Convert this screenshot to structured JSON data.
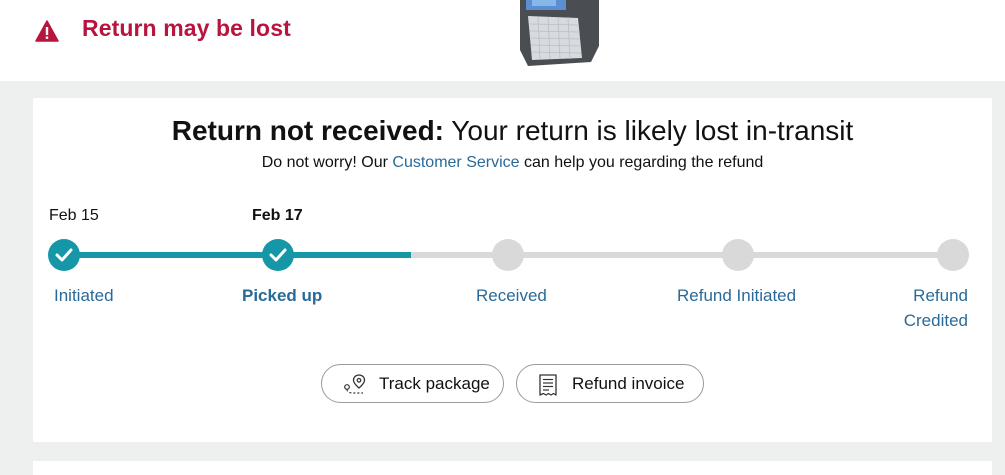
{
  "banner": {
    "title": "Return may be lost",
    "icon": "warning-triangle-icon",
    "accent_color": "#b7153e"
  },
  "status": {
    "heading_strong": "Return not received:",
    "heading_rest": " Your return is likely lost in-transit",
    "sub_before": "Do not worry! Our ",
    "sub_link": "Customer Service",
    "sub_after": " can help you regarding the refund"
  },
  "timeline": {
    "progress_color": "#1597a7",
    "pending_color": "#d9d9d9",
    "progress_fraction": 0.39,
    "steps": [
      {
        "label": "Initiated",
        "date": "Feb 15",
        "done": true,
        "current": false
      },
      {
        "label": "Picked up",
        "date": "Feb 17",
        "done": true,
        "current": true
      },
      {
        "label": "Received",
        "date": "",
        "done": false,
        "current": false
      },
      {
        "label": "Refund Initiated",
        "date": "",
        "done": false,
        "current": false
      },
      {
        "label": "Refund\nCredited",
        "date": "",
        "done": false,
        "current": false
      }
    ]
  },
  "actions": {
    "track_label": "Track package",
    "track_icon": "map-pin-route-icon",
    "invoice_label": "Refund invoice",
    "invoice_icon": "receipt-icon"
  }
}
